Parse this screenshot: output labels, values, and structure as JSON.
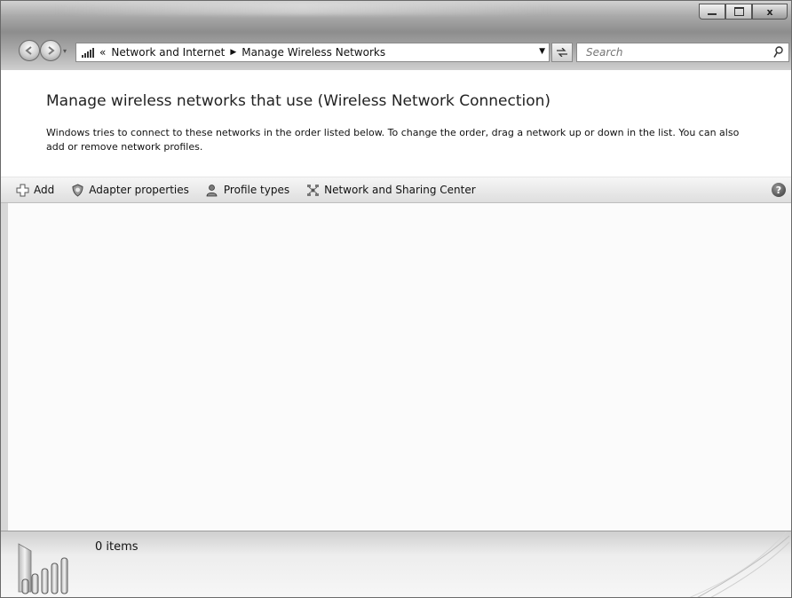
{
  "address": {
    "overflow_glyph": "«",
    "crumbs": [
      "Network and Internet",
      "Manage Wireless Networks"
    ]
  },
  "search": {
    "placeholder": "Search"
  },
  "header": {
    "title": "Manage wireless networks that use (Wireless Network Connection)",
    "description": "Windows tries to connect to these networks in the order listed below. To change the order, drag a network up or down in the list. You can also add or remove network profiles."
  },
  "toolbar": {
    "items": [
      {
        "label": "Add",
        "icon": "add-icon"
      },
      {
        "label": "Adapter properties",
        "icon": "shield-icon"
      },
      {
        "label": "Profile types",
        "icon": "user-icon"
      },
      {
        "label": "Network and Sharing Center",
        "icon": "network-icon"
      }
    ],
    "help_glyph": "?"
  },
  "details": {
    "item_count": "0 items"
  },
  "colors": {
    "chrome": "#a9a9a9",
    "background": "#ffffff",
    "commandbar": "#e6e6e6"
  }
}
